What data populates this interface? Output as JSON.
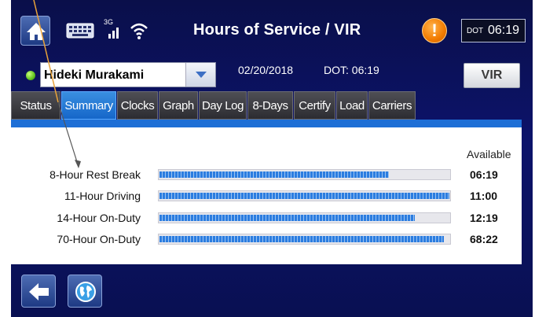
{
  "header": {
    "title": "Hours of Service / VIR",
    "network_label": "3G",
    "dot_label": "DOT",
    "dot_time": "06:19",
    "alert_symbol": "!"
  },
  "driver": {
    "name": "Hideki Murakami",
    "date": "02/20/2018",
    "dot_info": "DOT: 06:19",
    "vir_label": "VIR",
    "status_color": "#5fc21e"
  },
  "tabs": [
    {
      "label": "Status",
      "active": false
    },
    {
      "label": "Summary",
      "active": true
    },
    {
      "label": "Clocks",
      "active": false
    },
    {
      "label": "Graph",
      "active": false
    },
    {
      "label": "Day Log",
      "active": false
    },
    {
      "label": "8-Days",
      "active": false
    },
    {
      "label": "Certify",
      "active": false
    },
    {
      "label": "Load",
      "active": false
    },
    {
      "label": "Carriers",
      "active": false
    }
  ],
  "summary": {
    "available_header": "Available",
    "rows": [
      {
        "label": "8-Hour Rest Break",
        "value": "06:19",
        "progress": 0.79
      },
      {
        "label": "11-Hour Driving",
        "value": "11:00",
        "progress": 1.0
      },
      {
        "label": "14-Hour On-Duty",
        "value": "12:19",
        "progress": 0.88
      },
      {
        "label": "70-Hour On-Duty",
        "value": "68:22",
        "progress": 0.98
      }
    ]
  },
  "footer": {
    "back_icon": "arrow-left-icon",
    "globe_icon": "globe-icon"
  },
  "colors": {
    "accent": "#1566c9",
    "alert": "#f27b00",
    "annotation": "#e8a23a"
  }
}
